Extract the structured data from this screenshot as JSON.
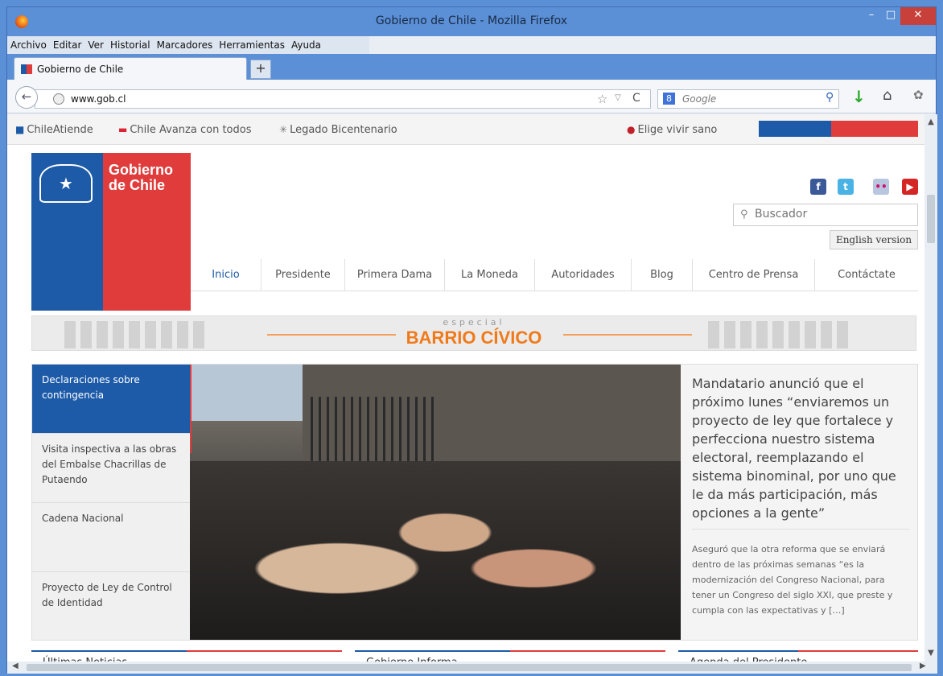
{
  "window": {
    "title": "Gobierno de Chile - Mozilla Firefox",
    "min": "–",
    "max": "□",
    "close": "✕"
  },
  "menu": [
    "Archivo",
    "Editar",
    "Ver",
    "Historial",
    "Marcadores",
    "Herramientas",
    "Ayuda"
  ],
  "tab": {
    "label": "Gobierno de Chile",
    "new_tab": "+"
  },
  "nav": {
    "url": "www.gob.cl",
    "search_placeholder": "Google"
  },
  "topbar": {
    "links": [
      "ChileAtiende",
      "Chile Avanza con todos",
      "Legado Bicentenario"
    ],
    "right_link": "Elige vivir sano"
  },
  "logo": {
    "line1": "Gobierno",
    "line2": "de Chile"
  },
  "site_search": {
    "placeholder": "Buscador"
  },
  "english_btn": "English version",
  "main_nav": [
    "Inicio",
    "Presidente",
    "Primera Dama",
    "La Moneda",
    "Autoridades",
    "Blog",
    "Centro de Prensa",
    "Contáctate"
  ],
  "banner": {
    "special": "especial",
    "title": "BARRIO CÍVICO"
  },
  "feature": {
    "side_items": [
      "Declaraciones sobre contingencia",
      "Visita inspectiva a las obras del Embalse Chacrillas de Putaendo",
      "Cadena Nacional",
      "Proyecto de Ley de Control de Identidad"
    ],
    "headline": "Mandatario anunció que el próximo lunes “enviaremos un proyecto de ley que fortalece y perfecciona nuestro sistema electoral, reemplazando el sistema binominal, por uno que le da más participación, más opciones a la gente”",
    "summary": "Aseguró que la otra reforma que se enviará dentro de las próximas semanas “es la modernización del Congreso Nacional, para tener un Congreso del siglo XXI, que preste y cumpla con las expectativas y […]"
  },
  "bottom_boxes": [
    "Últimas Noticias",
    "Gobierno Informa",
    "Agenda del Presidente"
  ],
  "colors": {
    "blue": "#1d5aa8",
    "red": "#e03c3c",
    "banner_orange": "#f07a1a"
  }
}
